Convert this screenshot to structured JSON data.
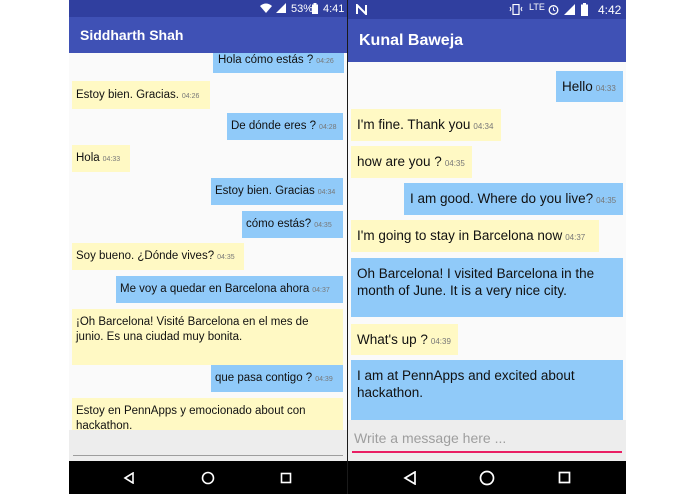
{
  "left_phone": {
    "status": {
      "battery": "53%",
      "time": "4:41"
    },
    "title": "Siddharth Shah",
    "input_placeholder": "",
    "messages": [
      {
        "text": "Hola cómo estás ?",
        "time": "04:26"
      },
      {
        "text": "Estoy bien. Gracias.",
        "time": "04:26"
      },
      {
        "text": "De dónde eres ?",
        "time": "04:28"
      },
      {
        "text": "Hola",
        "time": "04:33"
      },
      {
        "text": "Estoy bien. Gracias",
        "time": "04:34"
      },
      {
        "text": "cómo estás?",
        "time": "04:35"
      },
      {
        "text": "Soy bueno. ¿Dónde vives?",
        "time": "04:35"
      },
      {
        "text": "Me voy a quedar en Barcelona ahora",
        "time": "04:37"
      },
      {
        "line1": "¡Oh Barcelona! Visité Barcelona en el mes de",
        "line2": "junio. Es una ciudad muy bonita."
      },
      {
        "text": "que pasa contigo ?",
        "time": "04:39"
      },
      {
        "line1": "Estoy en PennApps y emocionado about con",
        "line2": "hackathon."
      }
    ]
  },
  "right_phone": {
    "status": {
      "network": "LTE",
      "time": "4:42"
    },
    "title": "Kunal Baweja",
    "input_placeholder": "Write a message here ...",
    "messages": [
      {
        "text": "Hello",
        "time": "04:33"
      },
      {
        "text": "I'm fine. Thank you",
        "time": "04:34"
      },
      {
        "text": "how are you ?",
        "time": "04:35"
      },
      {
        "text": "I am good. Where do you live?",
        "time": "04:35"
      },
      {
        "text": "I'm going to stay in Barcelona now",
        "time": "04:37"
      },
      {
        "line1": "Oh Barcelona! I visited Barcelona in the",
        "line2": "month of June. It is a very nice city."
      },
      {
        "text": "What's up ?",
        "time": "04:39"
      },
      {
        "line1": "I am at PennApps and excited about",
        "line2": "hackathon."
      }
    ]
  },
  "icons": {
    "wifi": "wifi-icon",
    "signal": "signal-icon",
    "battery": "battery-icon",
    "notification": "n-notification-icon",
    "vibrate": "vibrate-icon",
    "alarm": "alarm-icon",
    "back": "back-triangle-icon",
    "home": "home-circle-icon",
    "recents": "recents-square-icon"
  },
  "colors": {
    "appbar": "#3f51b5",
    "statusbar": "#303f9f",
    "sent_bubble": "#90caf9",
    "received_bubble": "#fff9c4",
    "input_accent": "#e91e63"
  }
}
